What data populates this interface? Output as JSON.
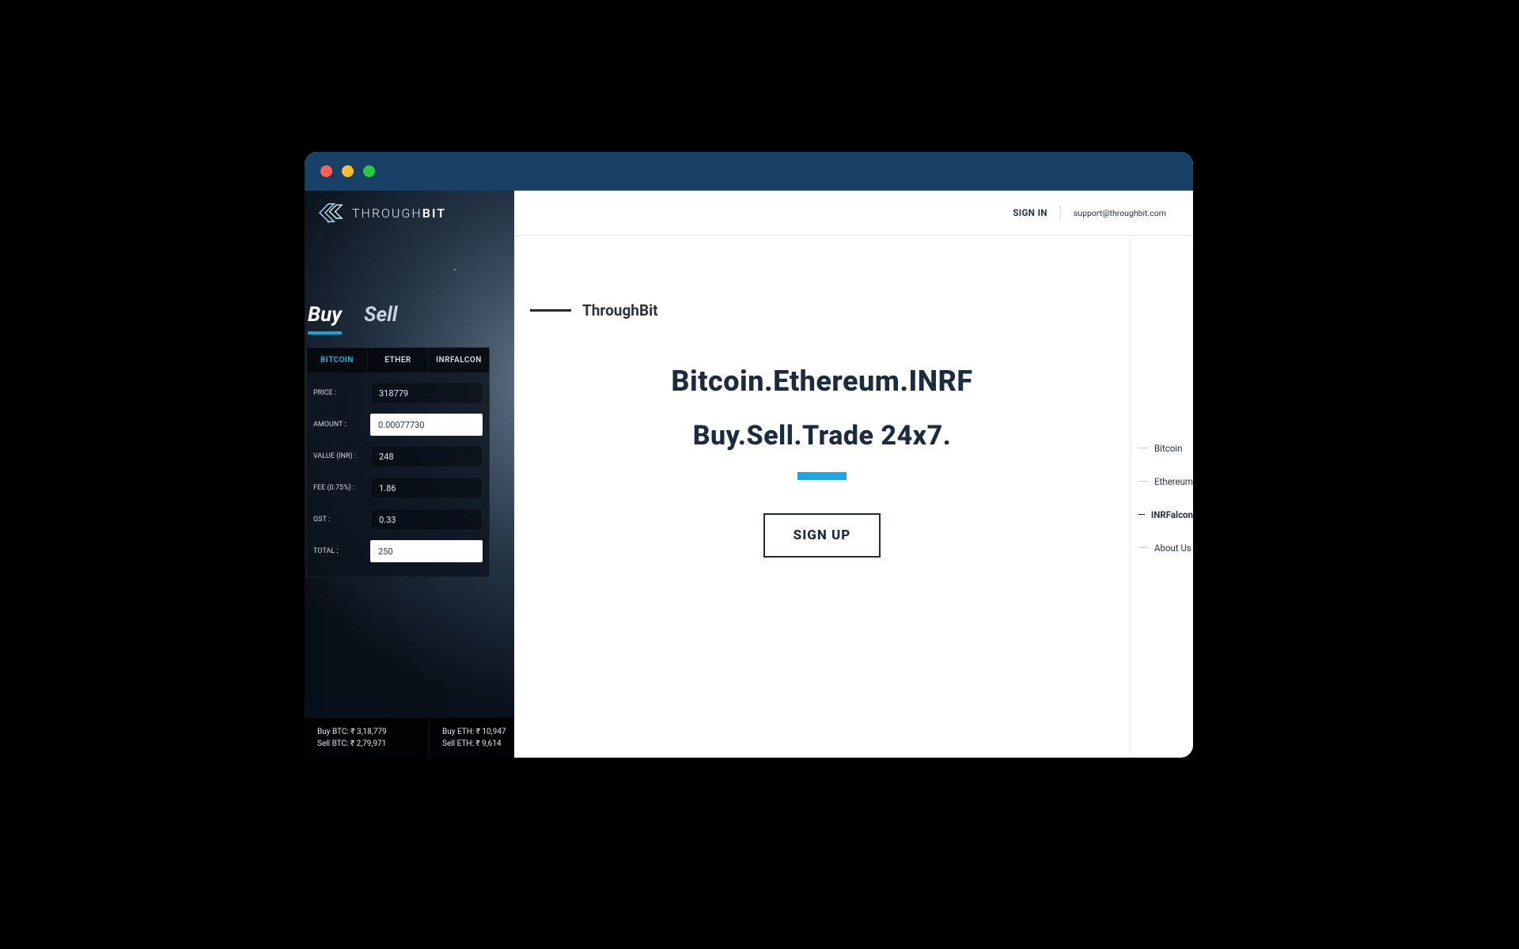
{
  "brand": {
    "name_thin": "THROUGH",
    "name_bold": "BIT"
  },
  "topbar": {
    "sign_in": "SIGN IN",
    "support_email": "support@throughbit.com"
  },
  "sidebar": {
    "mode_tabs": [
      {
        "label": "Buy",
        "active": true
      },
      {
        "label": "Sell",
        "active": false
      }
    ],
    "coin_tabs": [
      {
        "label": "BITCOIN",
        "active": true
      },
      {
        "label": "ETHER",
        "active": false
      },
      {
        "label": "INRFALCON",
        "active": false
      }
    ],
    "form": {
      "price_label": "PRICE :",
      "price_value": "318779",
      "amount_label": "AMOUNT :",
      "amount_value": "0.00077730",
      "value_label": "VALUE (INR) :",
      "value_value": "248",
      "fee_label": "FEE (0.75%) :",
      "fee_value": "1.86",
      "gst_label": "GST :",
      "gst_value": "0.33",
      "total_label": "TOTAL :",
      "total_value": "250"
    }
  },
  "ticker": {
    "btc_buy": "Buy BTC: ₹ 3,18,779",
    "btc_sell": "Sell BTC: ₹ 2,79,971",
    "eth_buy": "Buy ETH: ₹ 10,947",
    "eth_sell": "Sell ETH: ₹ 9,614"
  },
  "hero": {
    "kicker": "ThroughBit",
    "line1": "Bitcoin.Ethereum.INRF",
    "line2": "Buy.Sell.Trade 24x7.",
    "cta": "SIGN UP"
  },
  "rightnav": [
    {
      "label": "Bitcoin",
      "active": false
    },
    {
      "label": "Ethereum",
      "active": false
    },
    {
      "label": "INRFalcon",
      "active": true
    },
    {
      "label": "About Us",
      "active": false
    }
  ]
}
